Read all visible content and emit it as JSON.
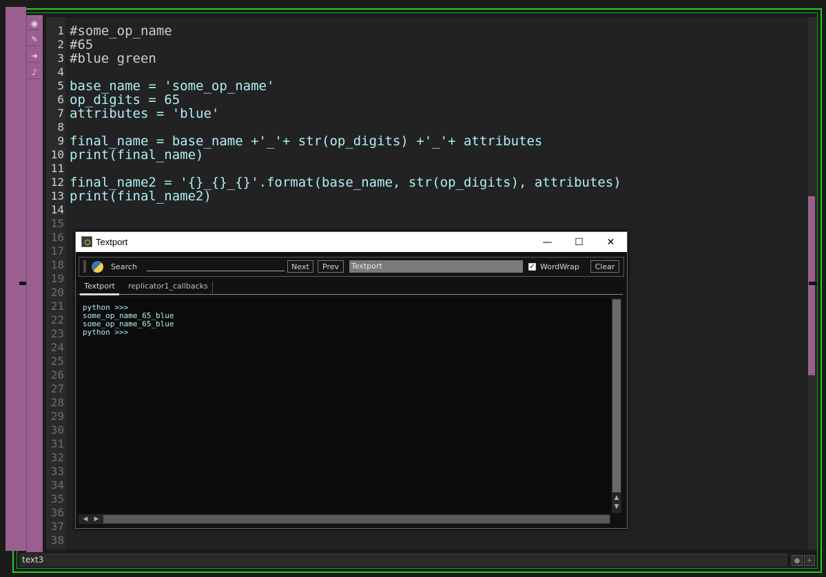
{
  "editor": {
    "lines": [
      {
        "n": "1",
        "text": "#some_op_name",
        "kind": "comment"
      },
      {
        "n": "2",
        "text": "#65",
        "kind": "comment"
      },
      {
        "n": "3",
        "text": "#blue green",
        "kind": "comment"
      },
      {
        "n": "4",
        "text": "",
        "kind": "code"
      },
      {
        "n": "5",
        "text": "base_name = 'some_op_name'",
        "kind": "code"
      },
      {
        "n": "6",
        "text": "op_digits = 65",
        "kind": "code"
      },
      {
        "n": "7",
        "text": "attributes = 'blue'",
        "kind": "code"
      },
      {
        "n": "8",
        "text": "",
        "kind": "code"
      },
      {
        "n": "9",
        "text": "final_name = base_name +'_'+ str(op_digits) +'_'+ attributes",
        "kind": "code"
      },
      {
        "n": "10",
        "text": "print(final_name)",
        "kind": "code"
      },
      {
        "n": "11",
        "text": "",
        "kind": "code"
      },
      {
        "n": "12",
        "text": "final_name2 = '{}_{}_{}'.format(base_name, str(op_digits), attributes)",
        "kind": "code"
      },
      {
        "n": "13",
        "text": "print(final_name2)",
        "kind": "code"
      },
      {
        "n": "14",
        "text": "",
        "kind": "code"
      }
    ],
    "empty_line_numbers": [
      "15",
      "16",
      "17",
      "18",
      "19",
      "20",
      "21",
      "22",
      "23",
      "24",
      "25",
      "26",
      "27",
      "28",
      "29",
      "30",
      "31",
      "32",
      "33",
      "34",
      "35",
      "36",
      "37",
      "38"
    ]
  },
  "status": {
    "node_name": "text3"
  },
  "textport": {
    "title": "Textport",
    "search_label": "Search",
    "next_label": "Next",
    "prev_label": "Prev",
    "field_value": "Textport",
    "wordwrap_label": "WordWrap",
    "clear_label": "Clear",
    "tabs": [
      "Textport",
      "replicator1_callbacks"
    ],
    "output": [
      "python >>>",
      "some_op_name_65_blue",
      "some_op_name_65_blue",
      "python >>>"
    ]
  },
  "colors": {
    "frame": "#1fd21f",
    "accent": "#9a5f8f",
    "code_text": "#aef0f4"
  }
}
